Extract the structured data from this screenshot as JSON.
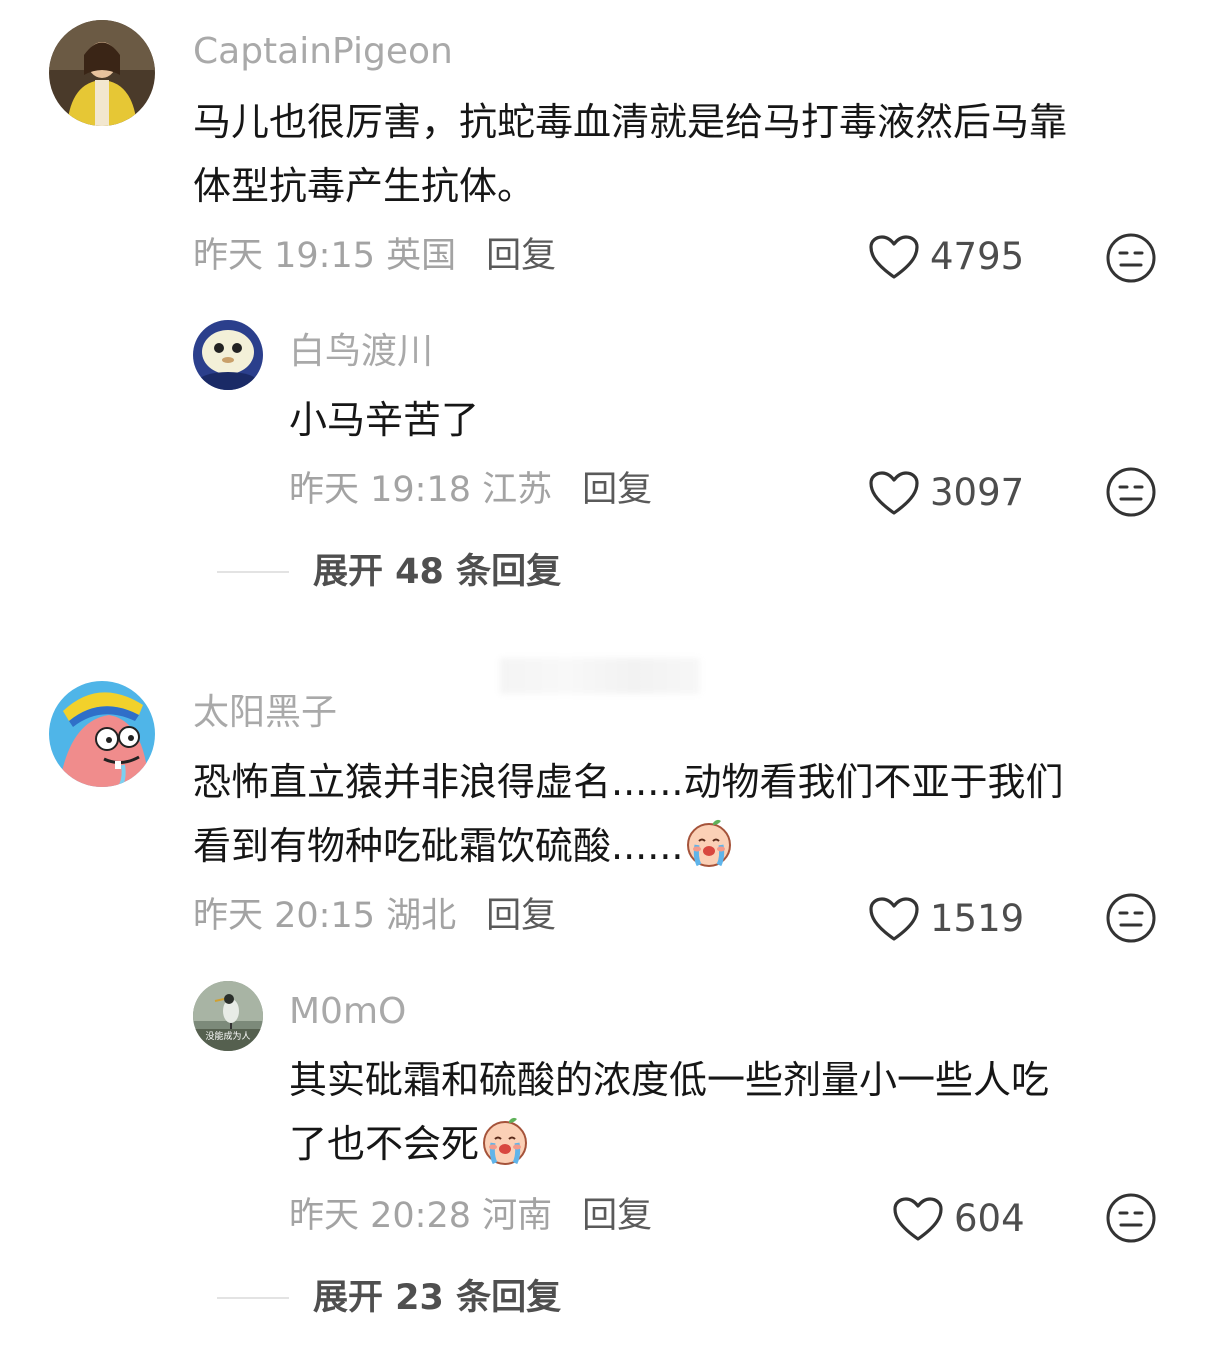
{
  "comments": [
    {
      "user": "CaptainPigeon",
      "text_line1": "马儿也很厉害，抗蛇毒血清就是给马打毒液然后马靠",
      "text_line2": "体型抗毒产生抗体。",
      "meta": "昨天 19:15 英国",
      "reply_label": "回复",
      "likes": "4795",
      "avatar_icon": "woman-yellow-jacket-avatar"
    },
    {
      "user": "太阳黑子",
      "text_line1": "恐怖直立猿并非浪得虚名......动物看我们不亚于我们",
      "text_line2": "看到有物种吃砒霜饮硫酸......",
      "meta": "昨天 20:15 湖北",
      "reply_label": "回复",
      "likes": "1519",
      "avatar_icon": "patrick-star-avatar"
    }
  ],
  "replies": [
    {
      "user": "白鸟渡川",
      "text": "小马辛苦了",
      "meta": "昨天 19:18 江苏",
      "reply_label": "回复",
      "likes": "3097",
      "avatar_icon": "white-blob-avatar"
    },
    {
      "user": "M0mO",
      "text_line1": "其实砒霜和硫酸的浓度低一些剂量小一些人吃",
      "text_line2": "了也不会死",
      "meta": "昨天 20:28 河南",
      "reply_label": "回复",
      "likes": "604",
      "avatar_icon": "heron-avatar",
      "avatar_caption": "没能成为人"
    }
  ],
  "expand": [
    {
      "label": "展开 48 条回复"
    },
    {
      "label": "展开 23 条回复"
    }
  ],
  "icons": {
    "like": "heart-outline-icon",
    "dislike": "meh-face-icon",
    "emoji": "crying-face-emoji"
  },
  "colors": {
    "username": "#a9a9a9",
    "meta": "#a3a3a3",
    "text": "#161616"
  }
}
